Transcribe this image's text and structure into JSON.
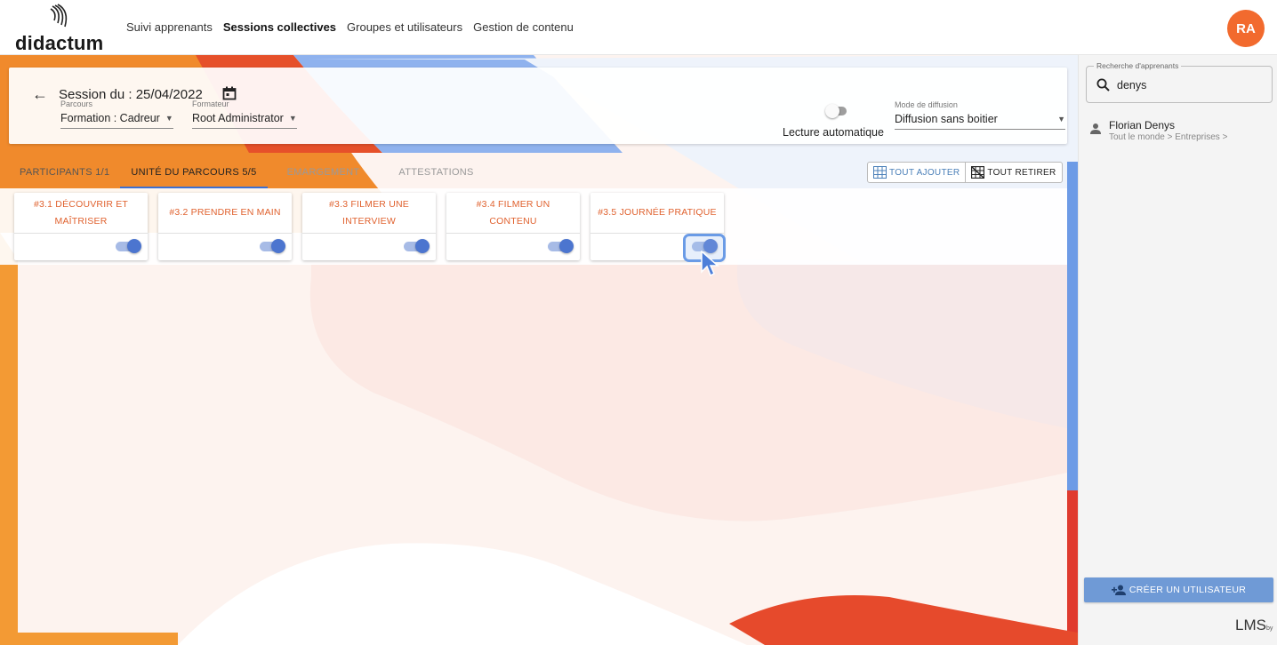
{
  "app": {
    "logo_text": "didactum",
    "avatar_initials": "RA"
  },
  "topnav": {
    "items": [
      {
        "label": "Suivi apprenants"
      },
      {
        "label": "Sessions collectives"
      },
      {
        "label": "Groupes et utilisateurs"
      },
      {
        "label": "Gestion de contenu"
      }
    ]
  },
  "session": {
    "title": "Session du : 25/04/2022",
    "parcours": {
      "label": "Parcours",
      "value": "Formation : Cadreur"
    },
    "formateur": {
      "label": "Formateur",
      "value": "Root Administrator"
    },
    "auto_read_label": "Lecture automatique",
    "diffusion": {
      "label": "Mode de diffusion",
      "value": "Diffusion sans boitier"
    }
  },
  "tabs": [
    {
      "label": "PARTICIPANTS 1/1"
    },
    {
      "label": "UNITÉ DU PARCOURS 5/5"
    },
    {
      "label": "EMARGEMENT"
    },
    {
      "label": "ATTESTATIONS"
    }
  ],
  "actions": {
    "add_all": "TOUT AJOUTER",
    "remove_all": "TOUT RETIRER"
  },
  "units": [
    {
      "title": "#3.1 DÉCOUVRIR ET MAÎTRISER",
      "enabled": true
    },
    {
      "title": "#3.2 PRENDRE EN MAIN",
      "enabled": true
    },
    {
      "title": "#3.3 FILMER UNE INTERVIEW",
      "enabled": true
    },
    {
      "title": "#3.4 FILMER UN CONTENU",
      "enabled": true
    },
    {
      "title": "#3.5 JOURNÉE PRATIQUE",
      "enabled": true
    }
  ],
  "sidebar": {
    "search": {
      "label": "Recherche d'apprenants",
      "value": "denys"
    },
    "results": [
      {
        "name": "Florian Denys",
        "path": "Tout le monde > Entreprises >"
      }
    ],
    "create_button": "CRÉER UN UTILISATEUR",
    "footer_brand": "LMS",
    "footer_by": "by"
  },
  "colors": {
    "accent_orange": "#e0622f",
    "primary_blue": "#4c75cf",
    "avatar": "#f26a2e"
  }
}
